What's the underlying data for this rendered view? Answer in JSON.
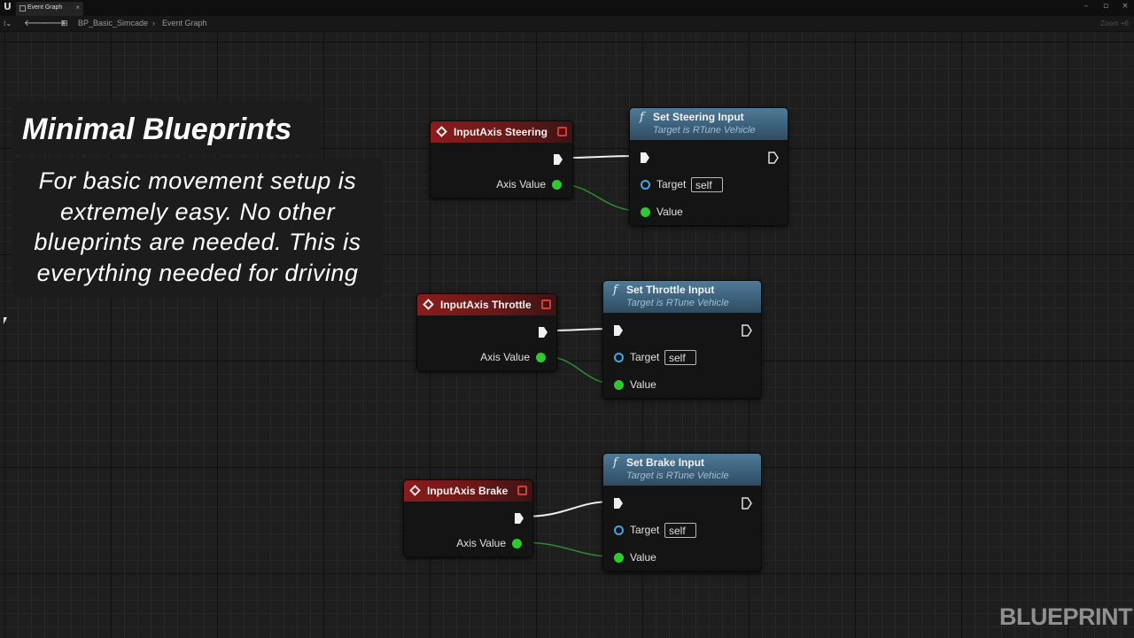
{
  "app": {
    "logo_glyph": "U",
    "tab_label": "Event Graph",
    "tab_close": "×",
    "window_controls": [
      "–",
      "▫",
      "×"
    ]
  },
  "toolbar": {
    "menu_glyph": "⁞⌄",
    "back_glyph": "🡐",
    "forward_glyph": "🡒",
    "breadcrumb": [
      "BP_Basic_Simcade",
      "Event Graph"
    ],
    "breadcrumb_sep": "›",
    "zoom_label": "Zoom +6"
  },
  "overlay": {
    "title": "Minimal Blueprints",
    "body": "For basic movement setup is extremely easy. No other blueprints are needed. This is everything needed for driving"
  },
  "nodes": {
    "steering_event": {
      "title": "InputAxis Steering",
      "output_label": "Axis Value"
    },
    "steering_func": {
      "title": "Set Steering Input",
      "subtitle": "Target is RTune Vehicle",
      "target_label": "Target",
      "target_value": "self",
      "value_label": "Value"
    },
    "throttle_event": {
      "title": "InputAxis Throttle",
      "output_label": "Axis Value"
    },
    "throttle_func": {
      "title": "Set Throttle Input",
      "subtitle": "Target is RTune Vehicle",
      "target_label": "Target",
      "target_value": "self",
      "value_label": "Value"
    },
    "brake_event": {
      "title": "InputAxis Brake",
      "output_label": "Axis Value"
    },
    "brake_func": {
      "title": "Set Brake Input",
      "subtitle": "Target is RTune Vehicle",
      "target_label": "Target",
      "target_value": "self",
      "value_label": "Value"
    }
  },
  "watermark": "BLUEPRINT",
  "colors": {
    "event_header": "#8a1c1c",
    "function_header": "#4e7a98",
    "float_pin": "#32c832",
    "object_pin": "#3fa5e6",
    "exec_wire": "#f0f0f0",
    "float_wire": "#2f8a2f"
  }
}
